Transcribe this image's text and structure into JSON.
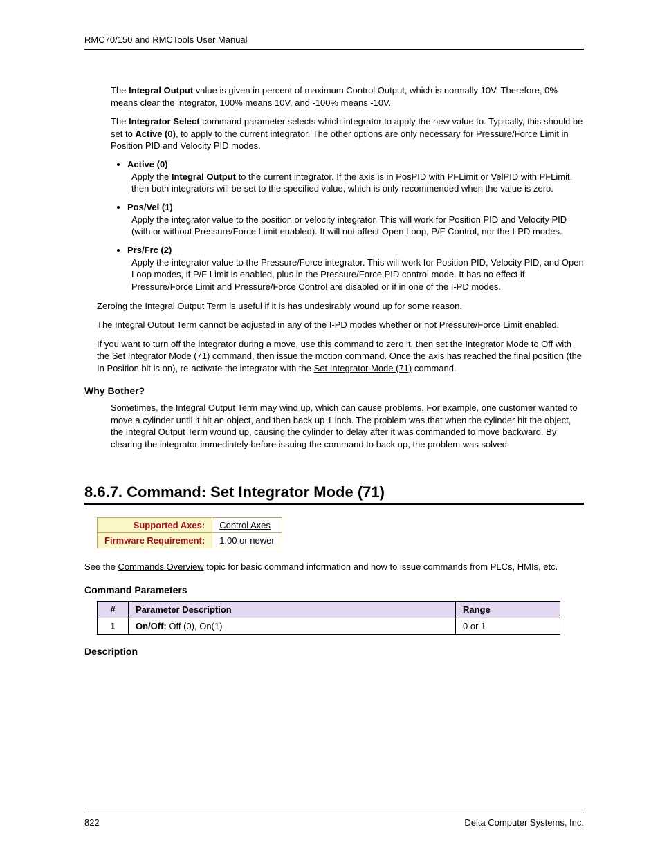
{
  "header": "RMC70/150 and RMCTools User Manual",
  "p1a": "The ",
  "p1b": "Integral Output",
  "p1c": " value is given in percent of maximum Control Output, which is normally 10V. Therefore, 0% means clear the integrator, 100% means 10V, and -100% means -10V.",
  "p2a": "The ",
  "p2b": "Integrator Select",
  "p2c": " command parameter selects which integrator to apply the new value to. Typically, this should be set to ",
  "p2d": "Active (0)",
  "p2e": ", to apply to the current integrator. The other options are only necessary for Pressure/Force Limit in Position PID and Velocity PID modes.",
  "b1h": "Active (0)",
  "b1a": "Apply the ",
  "b1b": "Integral Output",
  "b1c": " to the current integrator. If the axis is in PosPID with PFLimit or VelPID with PFLimit, then both integrators will be set to the specified value, which is only recommended when the value is zero.",
  "b2h": "Pos/Vel (1)",
  "b2t": "Apply the integrator value to the position or velocity integrator. This will work for Position PID and Velocity PID (with or without Pressure/Force Limit enabled). It will not affect Open Loop, P/F Control, nor the I-PD modes.",
  "b3h": "Prs/Frc (2)",
  "b3t": "Apply the integrator value to the Pressure/Force integrator. This will work for Position PID, Velocity PID, and Open Loop modes, if P/F Limit is enabled, plus in the Pressure/Force PID control mode. It has no effect if Pressure/Force Limit and Pressure/Force Control are disabled or if in one of the I-PD modes.",
  "p3": "Zeroing the Integral Output Term is useful if it is has undesirably wound up for some reason.",
  "p4": "The Integral Output Term cannot be adjusted in any of the I-PD modes whether or not Pressure/Force Limit enabled.",
  "p5a": "If you want to turn off the integrator during a move, use this command to zero it, then set the Integrator Mode to Off with the ",
  "p5link1": "Set Integrator Mode (71)",
  "p5b": " command, then issue the motion command. Once the axis has reached the final position (the In Position bit is on), re-activate the integrator with the ",
  "p5link2": "Set Integrator Mode (71)",
  "p5c": " command.",
  "why_head": "Why Bother?",
  "why_body": "Sometimes, the Integral Output Term may wind up, which can cause problems. For example, one customer wanted to move a cylinder until it hit an object, and then back up 1 inch. The problem was that when the cylinder hit the object, the Integral Output Term wound up, causing the cylinder to delay after it was commanded to move backward. By clearing the integrator immediately before issuing the command to back up, the problem was solved.",
  "section_title": "8.6.7. Command: Set Integrator Mode (71)",
  "info": {
    "r1l": "Supported Axes:",
    "r1v": "Control Axes",
    "r2l": "Firmware Requirement:",
    "r2v": "1.00 or newer"
  },
  "see_a": "See the ",
  "see_link": "Commands Overview",
  "see_b": " topic for basic command information and how to issue commands from PLCs, HMIs, etc.",
  "cp_head": "Command Parameters",
  "ptable": {
    "h1": "#",
    "h2": "Parameter Description",
    "h3": "Range",
    "r1c1": "1",
    "r1c2a": "On/Off:",
    "r1c2b": " Off (0), On(1)",
    "r1c3": "0 or 1"
  },
  "desc_head": "Description",
  "footer_left": "822",
  "footer_right": "Delta Computer Systems, Inc."
}
